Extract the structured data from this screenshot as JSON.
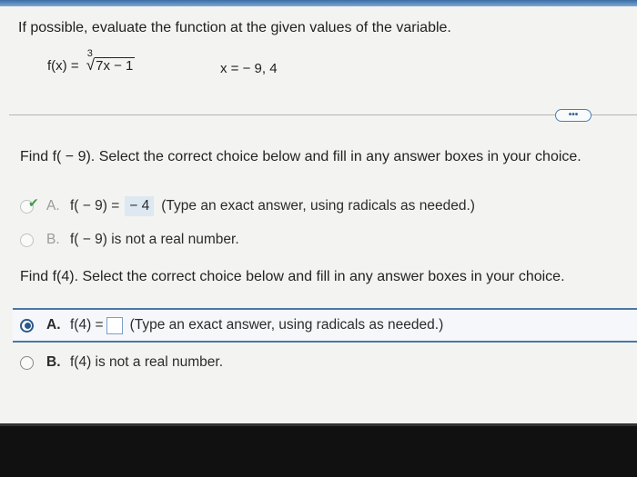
{
  "question": {
    "instruction": "If possible, evaluate the function at the given values of the variable.",
    "function_prefix": "f(x) =",
    "root_index": "3",
    "radicand": "7x − 1",
    "x_values": "x = − 9, 4"
  },
  "more_button": {
    "label": "•••"
  },
  "part1": {
    "prompt": "Find f( − 9). Select the correct choice below and fill in any answer boxes in your choice.",
    "choice_a": {
      "letter": "A.",
      "lhs": "f( − 9) =",
      "answer": "− 4",
      "hint": "(Type an exact answer, using radicals as needed.)",
      "state": "selected-correct"
    },
    "choice_b": {
      "letter": "B.",
      "text": "f( − 9) is not a real number.",
      "state": "unselected"
    }
  },
  "part2": {
    "prompt": "Find f(4). Select the correct choice below and fill in any answer boxes in your choice.",
    "choice_a": {
      "letter": "A.",
      "lhs": "f(4) =",
      "answer": "",
      "hint": "(Type an exact answer, using radicals as needed.)",
      "state": "selected"
    },
    "choice_b": {
      "letter": "B.",
      "text": "f(4) is not a real number.",
      "state": "unselected"
    }
  },
  "colors": {
    "accent": "#2b5a8a",
    "answer_highlight": "#dde8f3",
    "correct_check": "#3d9b48"
  }
}
